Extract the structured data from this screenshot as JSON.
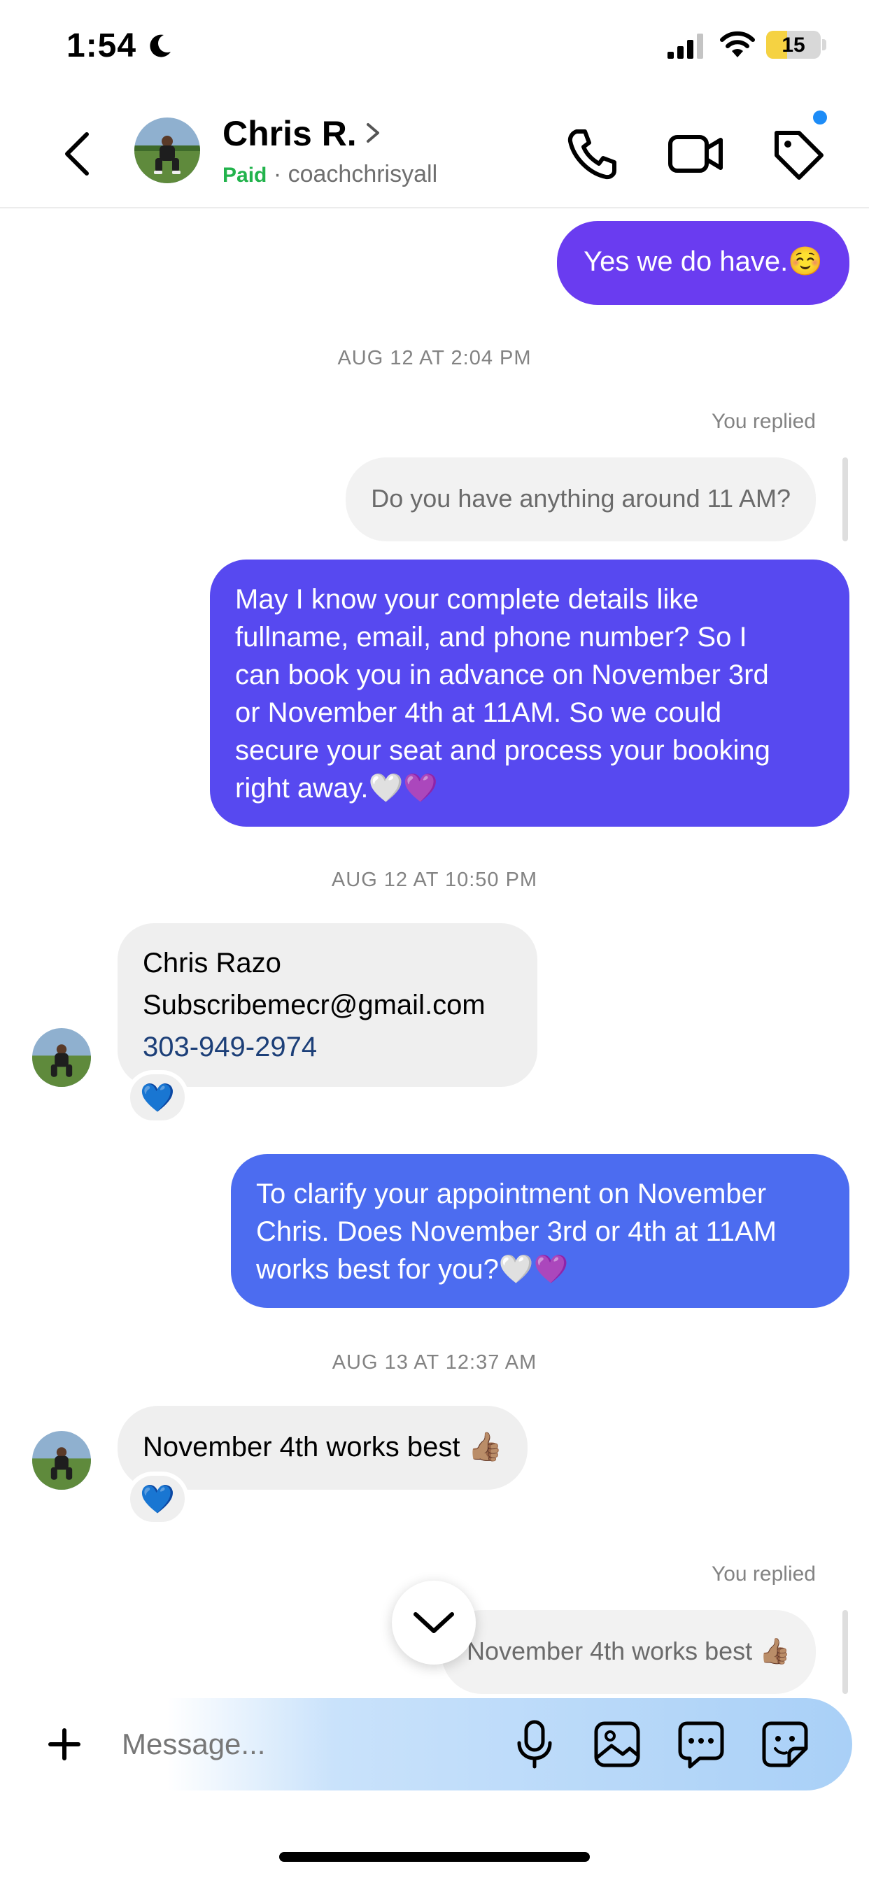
{
  "status_bar": {
    "time": "1:54",
    "battery": "15",
    "battery_level": 0.15
  },
  "header": {
    "name": "Chris R.",
    "paid_label": "Paid",
    "separator": "·",
    "username": "coachchrisyall"
  },
  "messages": {
    "m1": {
      "text": "Yes we do have.☺️"
    },
    "ts1": "AUG 12 AT 2:04 PM",
    "replied1": {
      "label": "You replied",
      "text": "Do you have anything around 11 AM?"
    },
    "m2": {
      "lines": [
        "May I know your complete details like",
        "fullname, email, and phone number? So I",
        "can book you in advance on November 3rd",
        "or November 4th at 11AM. So we could",
        "secure your seat and process your booking",
        "right away.🤍💜"
      ]
    },
    "ts2": "AUG 12 AT 10:50 PM",
    "m3": {
      "lines": [
        "Chris Razo",
        "Subscribemecr@gmail.com"
      ],
      "phone": "303-949-2974",
      "reaction": "💙"
    },
    "m4": {
      "lines": [
        "To clarify your appointment on November",
        "Chris. Does November 3rd or 4th at 11AM",
        "works best for you?🤍💜"
      ]
    },
    "ts3": "AUG 13 AT 12:37 AM",
    "m5": {
      "text": "November 4th works best 👍🏽",
      "reaction": "💙"
    },
    "replied2": {
      "label": "You replied",
      "text": "November 4th works best 👍🏽"
    }
  },
  "composer": {
    "placeholder": "Message..."
  },
  "colors": {
    "outgoing_purple": "#6a3cf0",
    "outgoing_blue": "#4c6cf0",
    "incoming_gray": "#efefef",
    "paid_green": "#22b34c",
    "link_blue": "#1c3f78",
    "notification_dot": "#1d8cf7"
  },
  "icons": {
    "status": [
      "moon-icon",
      "signal-icon",
      "wifi-icon",
      "battery-icon"
    ],
    "header": [
      "back-icon",
      "chevron-right-icon",
      "phone-icon",
      "video-icon",
      "tag-icon"
    ],
    "composer": [
      "plus-icon",
      "microphone-icon",
      "image-icon",
      "chat-bubble-icon",
      "sticker-icon"
    ],
    "scroll": "chevron-down-icon"
  }
}
